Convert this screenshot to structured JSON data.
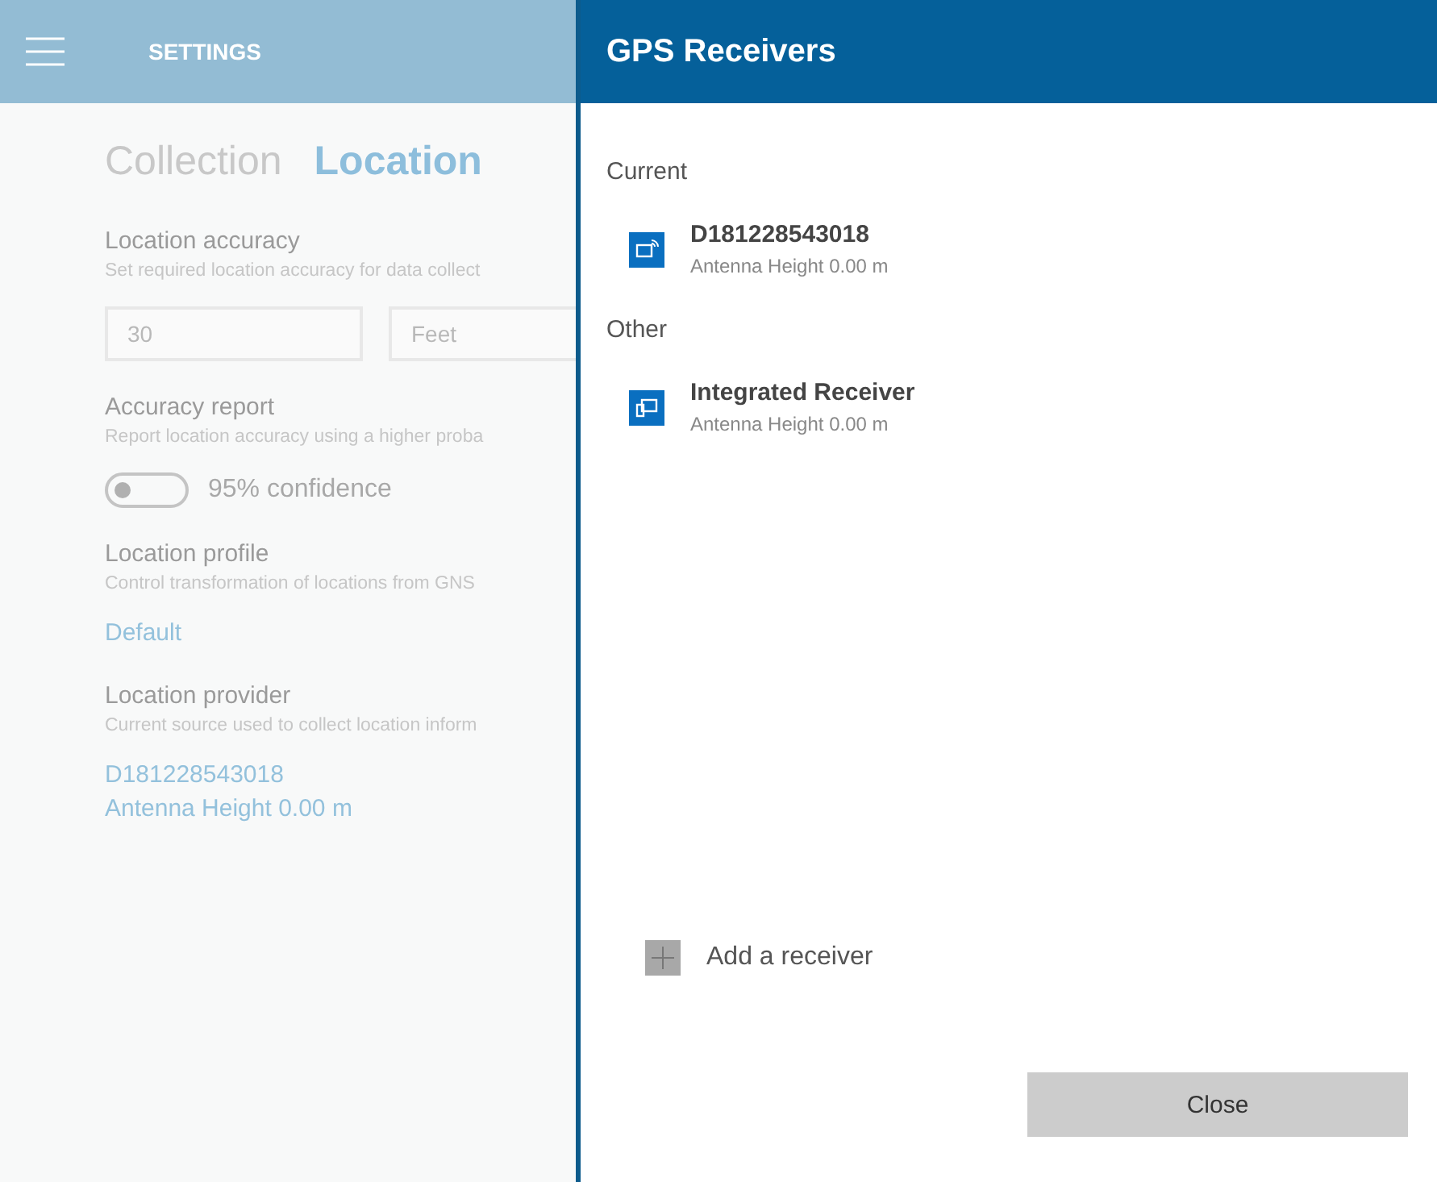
{
  "app_bar": {
    "title": "SETTINGS"
  },
  "tabs": [
    {
      "label": "Collection",
      "selected": false
    },
    {
      "label": "Location",
      "selected": true
    }
  ],
  "settings": [
    {
      "kind": "fields",
      "heading": "Location accuracy",
      "description": "Set required location accuracy for data collect",
      "fields": [
        {
          "value": "30"
        },
        {
          "value": "Feet"
        }
      ]
    },
    {
      "kind": "toggle",
      "heading": "Accuracy report",
      "description": "Report location accuracy using a higher proba",
      "toggle": {
        "label": "95% confidence",
        "on": false
      }
    },
    {
      "kind": "link",
      "heading": "Location profile",
      "description": "Control transformation of locations from GNS",
      "links": [
        "Default"
      ]
    },
    {
      "kind": "link",
      "heading": "Location provider",
      "description": "Current source used to collect location inform",
      "links": [
        "D181228543018",
        "Antenna Height 0.00 m"
      ]
    }
  ],
  "dialog": {
    "title": "GPS Receivers",
    "groups": [
      {
        "heading": "Current",
        "receivers": [
          {
            "kind": "bluetooth",
            "name": "D181228543018",
            "detail": "Antenna Height 0.00 m"
          }
        ]
      },
      {
        "heading": "Other",
        "receivers": [
          {
            "kind": "integrated",
            "name": "Integrated Receiver",
            "detail": "Antenna Height 0.00 m"
          }
        ]
      }
    ],
    "add_label": "Add a receiver",
    "buttons": [
      "Close"
    ]
  }
}
